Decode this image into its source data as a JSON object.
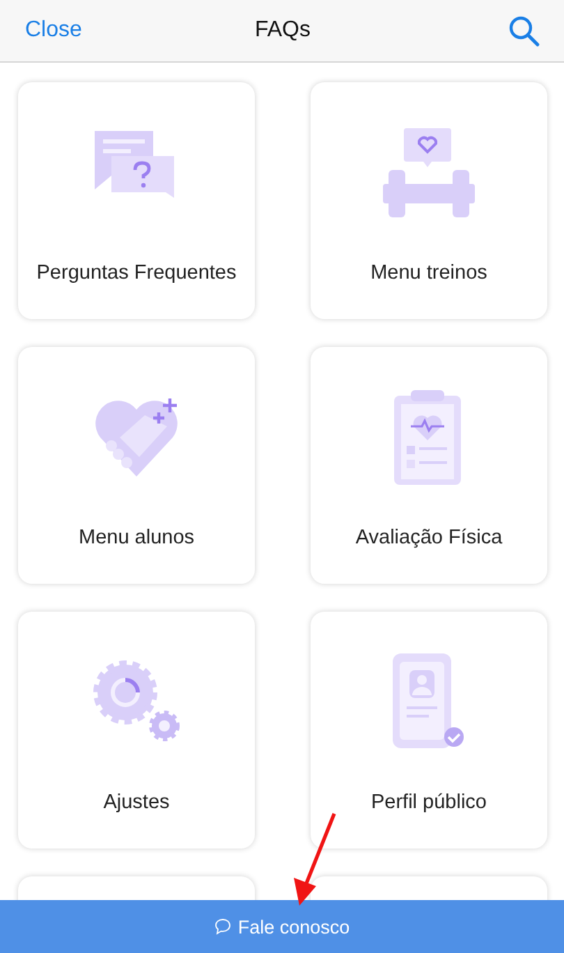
{
  "header": {
    "close": "Close",
    "title": "FAQs"
  },
  "cards": [
    {
      "label": "Perguntas Frequentes",
      "kind": "chat"
    },
    {
      "label": "Menu treinos",
      "kind": "dumbbell"
    },
    {
      "label": "Menu alunos",
      "kind": "handshake"
    },
    {
      "label": "Avaliação Física",
      "kind": "clipboard"
    },
    {
      "label": "Ajustes",
      "kind": "gears"
    },
    {
      "label": "Perfil público",
      "kind": "profile"
    }
  ],
  "footer": {
    "label": "Fale conosco"
  }
}
